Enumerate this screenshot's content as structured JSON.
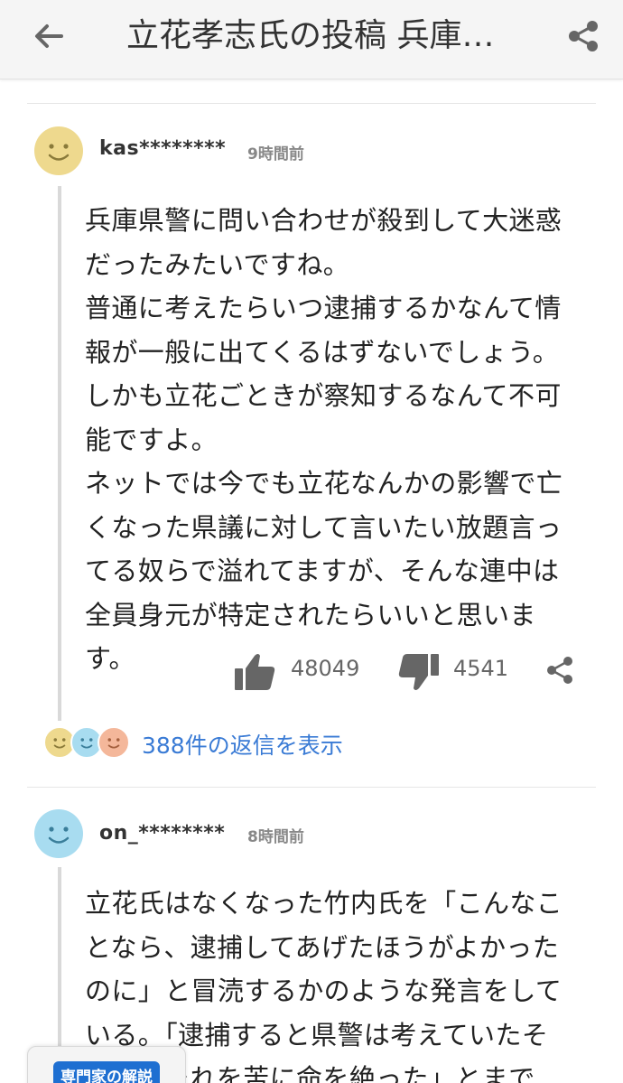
{
  "header": {
    "title": "立花孝志氏の投稿 兵庫…",
    "back_icon": "back-arrow-icon",
    "share_icon": "share-icon"
  },
  "comments": [
    {
      "username": "kas********",
      "time": "9時間前",
      "avatar_color": "#eed98e",
      "text": "兵庫県警に問い合わせが殺到して大迷惑\nだったみたいですね。\n普通に考えたらいつ逮捕するかなんて情\n報が一般に出てくるはずないでしょう。\nしかも立花ごときが察知するなんて不可\n能ですよ。\nネットでは今でも立花なんかの影響で亡\nくなった県議に対して言いたい放題言っ\nてる奴らで溢れてますが、そんな連中は\n全員身元が特定されたらいいと思いま\nす。",
      "likes": "48049",
      "dislikes": "4541",
      "replies_label": "388件の返信を表示"
    },
    {
      "username": "on_********",
      "time": "8時間前",
      "avatar_color": "#a8dcf0",
      "text": "立花氏はなくなった竹内氏を「こんなこ\nとなら、逮捕してあげたほうがよかった\nのに」と冒涜するかのような発言をして\nいる。「逮捕すると県警は考えていたそ\nうで、それを苦に命を絶った」とまで"
    }
  ],
  "reply_avatar_colors": [
    "#eed98e",
    "#a8dcf0",
    "#f4b79a"
  ],
  "expert": {
    "label": "専門家の解説"
  },
  "colors": {
    "link": "#3a7bd5",
    "expert_badge": "#1e6fd1"
  }
}
